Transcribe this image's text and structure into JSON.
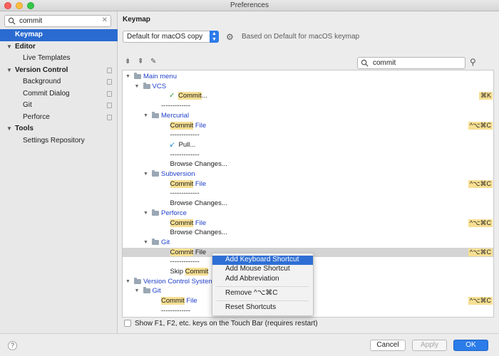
{
  "window": {
    "title": "Preferences"
  },
  "sidebar": {
    "search_value": "commit",
    "items": [
      {
        "label": "Keymap",
        "level": 0,
        "selected": true,
        "arrow": ""
      },
      {
        "label": "Editor",
        "level": 0,
        "bold": true,
        "arrow": "▼"
      },
      {
        "label": "Live Templates",
        "level": 1
      },
      {
        "label": "Version Control",
        "level": 0,
        "bold": true,
        "arrow": "▼",
        "page_icon": true
      },
      {
        "label": "Background",
        "level": 1,
        "page_icon": true
      },
      {
        "label": "Commit Dialog",
        "level": 1,
        "page_icon": true
      },
      {
        "label": "Git",
        "level": 1,
        "page_icon": true
      },
      {
        "label": "Perforce",
        "level": 1,
        "page_icon": true
      },
      {
        "label": "Tools",
        "level": 0,
        "bold": true,
        "arrow": "▼"
      },
      {
        "label": "Settings Repository",
        "level": 1
      }
    ]
  },
  "main": {
    "section_title": "Keymap",
    "scheme_value": "Default for macOS copy",
    "based_on": "Based on Default for macOS keymap",
    "filter_value": "commit",
    "tree": [
      {
        "level": 0,
        "arrow": "▼",
        "folder": true,
        "pre": "",
        "match": "",
        "post": "Main menu",
        "blue": true,
        "shortcut": ""
      },
      {
        "level": 1,
        "arrow": "▼",
        "folder": true,
        "pre": "",
        "match": "",
        "post": "VCS",
        "blue": true,
        "shortcut": ""
      },
      {
        "level": 2,
        "icon": "check",
        "pre": "",
        "match": "Commit",
        "post": "...",
        "shortcut": "⌘K"
      },
      {
        "level": 2,
        "pre": "",
        "match": "",
        "post": "-------------",
        "shortcut": ""
      },
      {
        "level": 2,
        "arrow": "▼",
        "folder": true,
        "pre": "",
        "match": "",
        "post": "Mercurial",
        "blue": true,
        "shortcut": ""
      },
      {
        "level": 3,
        "pre": "",
        "match": "Commit",
        "post": " File",
        "blue_post": true,
        "shortcut": "^⌥⌘C"
      },
      {
        "level": 3,
        "pre": "",
        "match": "",
        "post": "-------------",
        "shortcut": ""
      },
      {
        "level": 3,
        "icon": "pull",
        "pre": "",
        "match": "",
        "post": "Pull...",
        "shortcut": ""
      },
      {
        "level": 3,
        "pre": "",
        "match": "",
        "post": "-------------",
        "shortcut": ""
      },
      {
        "level": 3,
        "pre": "",
        "match": "",
        "post": "Browse Changes...",
        "shortcut": ""
      },
      {
        "level": 2,
        "arrow": "▼",
        "folder": true,
        "pre": "",
        "match": "",
        "post": "Subversion",
        "blue": true,
        "shortcut": ""
      },
      {
        "level": 3,
        "pre": "",
        "match": "Commit",
        "post": " File",
        "blue_post": true,
        "shortcut": "^⌥⌘C"
      },
      {
        "level": 3,
        "pre": "",
        "match": "",
        "post": "-------------",
        "shortcut": ""
      },
      {
        "level": 3,
        "pre": "",
        "match": "",
        "post": "Browse Changes...",
        "shortcut": ""
      },
      {
        "level": 2,
        "arrow": "▼",
        "folder": true,
        "pre": "",
        "match": "",
        "post": "Perforce",
        "blue": true,
        "shortcut": ""
      },
      {
        "level": 3,
        "pre": "",
        "match": "Commit",
        "post": " File",
        "blue_post": true,
        "shortcut": "^⌥⌘C"
      },
      {
        "level": 3,
        "pre": "",
        "match": "",
        "post": "Browse Changes...",
        "shortcut": ""
      },
      {
        "level": 2,
        "arrow": "▼",
        "folder": true,
        "pre": "",
        "match": "",
        "post": "Git",
        "blue": true,
        "shortcut": ""
      },
      {
        "level": 3,
        "pre": "",
        "match": "Commit",
        "post": " File",
        "highlight": true,
        "shortcut": "^⌥⌘C"
      },
      {
        "level": 3,
        "pre": "",
        "match": "",
        "post": "-------------",
        "shortcut": ""
      },
      {
        "level": 3,
        "pre": "Skip ",
        "match": "Commit",
        "post": "",
        "shortcut": ""
      },
      {
        "level": 0,
        "arrow": "▼",
        "folder": true,
        "pre": "",
        "match": "",
        "post": "Version Control System",
        "blue": true,
        "shortcut": ""
      },
      {
        "level": 1,
        "arrow": "▼",
        "folder": true,
        "pre": "",
        "match": "",
        "post": "Git",
        "blue": true,
        "shortcut": ""
      },
      {
        "level": 2,
        "pre": "",
        "match": "Commit",
        "post": " File",
        "blue_post": true,
        "shortcut": "^⌥⌘C"
      },
      {
        "level": 2,
        "pre": "",
        "match": "",
        "post": "-------------",
        "shortcut": ""
      }
    ],
    "touchbar_checkbox_label": "Show F1, F2, etc. keys on the Touch Bar (requires restart)"
  },
  "context_menu": {
    "items": [
      {
        "label": "Add Keyboard Shortcut",
        "active": true
      },
      {
        "label": "Add Mouse Shortcut"
      },
      {
        "label": "Add Abbreviation"
      },
      {
        "separator": true
      },
      {
        "label": "Remove ^⌥⌘C"
      },
      {
        "separator": true
      },
      {
        "label": "Reset Shortcuts"
      }
    ]
  },
  "footer": {
    "help_label": "?",
    "cancel_label": "Cancel",
    "apply_label": "Apply",
    "ok_label": "OK"
  }
}
